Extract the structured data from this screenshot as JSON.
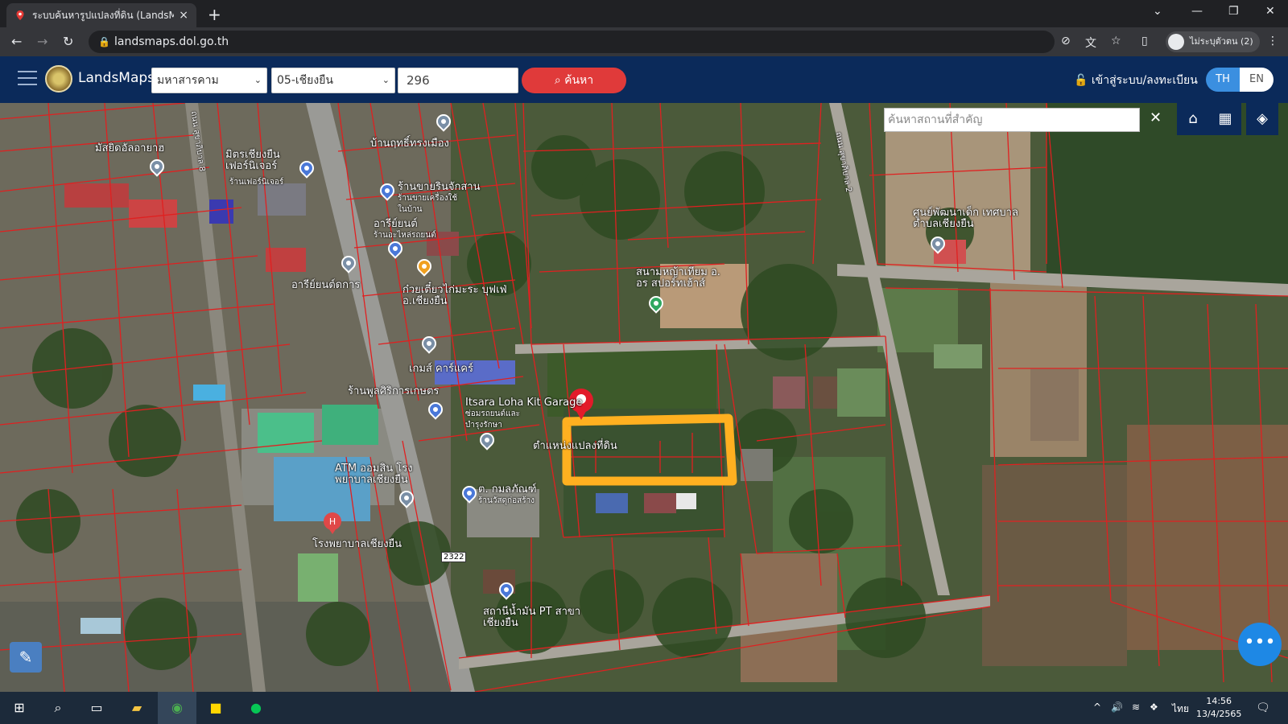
{
  "browser": {
    "tab_title": "ระบบค้นหารูปแปลงที่ดิน (LandsMaps",
    "tab_close": "×",
    "new_tab": "+",
    "url": "landsmaps.dol.go.th",
    "profile_label": "ไม่ระบุตัวตน (2)"
  },
  "header": {
    "brand": "LandsMaps",
    "province": "มหาสารคาม",
    "district": "05-เชียงยืน",
    "parcel_number": "296",
    "search_label": "ค้นหา",
    "login_label": "เข้าสู่ระบบ/ลงทะเบียน",
    "lang_th": "TH",
    "lang_en": "EN"
  },
  "map": {
    "place_search_placeholder": "ค้นหาสถานที่สำคัญ",
    "places": [
      {
        "id": "p1",
        "text": "มัสยิดอัลอายาฮ"
      },
      {
        "id": "p2",
        "text": "มิตรเชียงยืน เฟอร์นิเจอร์"
      },
      {
        "id": "p3",
        "text": "ร้านเฟอร์นิเจอร์"
      },
      {
        "id": "p4",
        "text": "บ้านฤทธิ์ทรงเมือง"
      },
      {
        "id": "p5",
        "text": "ร้านขายรินจักสาน"
      },
      {
        "id": "p6",
        "text": "ร้านขายเครื่องใช้ในบ้าน"
      },
      {
        "id": "p7",
        "text": "อารีย์ยนต์"
      },
      {
        "id": "p8",
        "text": "ร้านอะไหล่รถยนต์"
      },
      {
        "id": "p9",
        "text": "อารีย์ยนต์ดการ"
      },
      {
        "id": "p10",
        "text": "ก๋วยเตี๋ยวไก่มะระ บุฟเฟ่ อ.เชียงยืน"
      },
      {
        "id": "p11",
        "text": "สนามหญ้าเทียม อ. อร สปอร์ทเฮ้าส์"
      },
      {
        "id": "p12",
        "text": "เกมส์ คาร์แคร์"
      },
      {
        "id": "p13",
        "text": "ร้านพูลศิริการเกษตร"
      },
      {
        "id": "p14",
        "text": "Itsara Loha Kit Garage"
      },
      {
        "id": "p15",
        "text": "ซ่อมรถยนต์และบำรุงรักษา"
      },
      {
        "id": "p16",
        "text": "ตำแหน่งแปลงที่ดิน"
      },
      {
        "id": "p17",
        "text": "ATM ออมสิน โรงพยาบาลเชียงยืน"
      },
      {
        "id": "p18",
        "text": "ต. กมลภัณฑ์"
      },
      {
        "id": "p19",
        "text": "ร้านวัสดุก่อสร้าง"
      },
      {
        "id": "p20",
        "text": "โรงพยาบาลเชียงยืน"
      },
      {
        "id": "p21",
        "text": "สถานีน้ำมัน PT สาขา เชียงยืน"
      },
      {
        "id": "p22",
        "text": "ศูนย์พัฒนาเด็ก เทศบาลตำบลเชียงยืน"
      },
      {
        "id": "p23",
        "text": "ถนน สุขาภิบาล 8"
      },
      {
        "id": "p24",
        "text": "ถนน สุขาภิบาล 2"
      },
      {
        "id": "p25",
        "text": "2322"
      }
    ]
  },
  "taskbar": {
    "lang": "ไทย",
    "time": "14:56",
    "date": "13/4/2565"
  }
}
